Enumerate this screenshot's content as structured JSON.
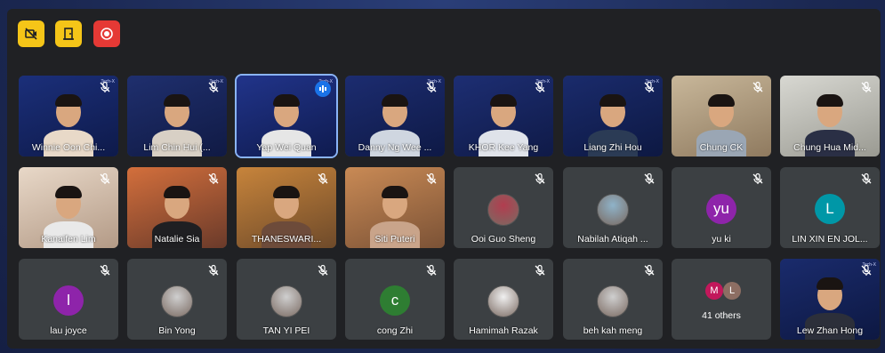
{
  "toolbar": {
    "buttons": [
      {
        "name": "camera-off-button",
        "icon": "camera-off-icon",
        "color": "#f5c518"
      },
      {
        "name": "leave-room-button",
        "icon": "door-icon",
        "color": "#f5c518"
      },
      {
        "name": "record-button",
        "icon": "record-icon",
        "color": "#e53935"
      }
    ]
  },
  "badge_text": "Tech-X",
  "others": {
    "label": "41 others",
    "initials": [
      "M",
      "L"
    ]
  },
  "participants": [
    {
      "name": "Winnie Oon Chi...",
      "type": "video"
    },
    {
      "name": "Lim Chin Hui (...",
      "type": "video"
    },
    {
      "name": "Yap Wei Quan",
      "type": "video",
      "speaking": true
    },
    {
      "name": "Danny Ng Wee ...",
      "type": "video"
    },
    {
      "name": "KHOR Kee Yang",
      "type": "video"
    },
    {
      "name": "Liang Zhi Hou",
      "type": "video"
    },
    {
      "name": "Chung CK",
      "type": "video"
    },
    {
      "name": "Chung Hua Mid...",
      "type": "video"
    },
    {
      "name": "Kanaifen Lim",
      "type": "video"
    },
    {
      "name": "Natalie Sia",
      "type": "video"
    },
    {
      "name": "THANESWARI...",
      "type": "video"
    },
    {
      "name": "Siti Puteri",
      "type": "video"
    },
    {
      "name": "Ooi Guo Sheng",
      "type": "avatar"
    },
    {
      "name": "Nabilah Atiqah ...",
      "type": "avatar"
    },
    {
      "name": "yu ki",
      "type": "initial",
      "initial": "yu",
      "color": "#8e24aa"
    },
    {
      "name": "LIN XIN EN JOL...",
      "type": "initial",
      "initial": "L",
      "color": "#0097a7"
    },
    {
      "name": "lau joyce",
      "type": "initial",
      "initial": "l",
      "color": "#8e24aa"
    },
    {
      "name": "Bin Yong",
      "type": "avatar"
    },
    {
      "name": "TAN YI PEI",
      "type": "avatar"
    },
    {
      "name": "cong Zhi",
      "type": "initial",
      "initial": "c",
      "color": "#2e7d32"
    },
    {
      "name": "Hamimah Razak",
      "type": "avatar"
    },
    {
      "name": "beh kah meng",
      "type": "avatar"
    },
    {
      "name": "41 others",
      "type": "others"
    },
    {
      "name": "Lew Zhan Hong",
      "type": "video"
    }
  ]
}
